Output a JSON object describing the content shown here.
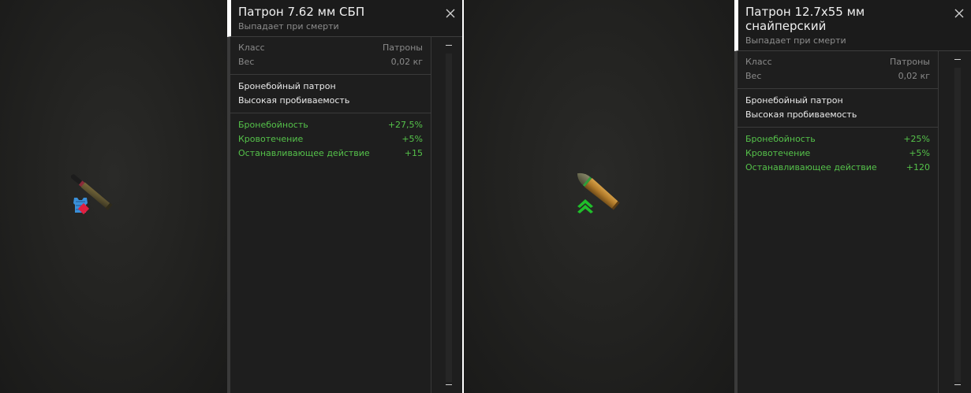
{
  "items": [
    {
      "title": "Патрон 7.62 мм СБП",
      "subtitle": "Выпадает при смерти",
      "class_label": "Класс",
      "class_value": "Патроны",
      "weight_label": "Вес",
      "weight_value": "0,02 кг",
      "desc_line1": "Бронебойный патрон",
      "desc_line2": "Высокая пробиваемость",
      "stats": [
        {
          "label": "Бронебойность",
          "value": "+27,5%"
        },
        {
          "label": "Кровотечение",
          "value": "+5%"
        },
        {
          "label": "Останавливающее действие",
          "value": "+15"
        }
      ]
    },
    {
      "title": "Патрон 12.7x55 мм снайперский",
      "subtitle": "Выпадает при смерти",
      "class_label": "Класс",
      "class_value": "Патроны",
      "weight_label": "Вес",
      "weight_value": "0,02 кг",
      "desc_line1": "Бронебойный патрон",
      "desc_line2": "Высокая пробиваемость",
      "stats": [
        {
          "label": "Бронебойность",
          "value": "+25%"
        },
        {
          "label": "Кровотечение",
          "value": "+5%"
        },
        {
          "label": "Останавливающее действие",
          "value": "+120"
        }
      ]
    }
  ],
  "icons": {
    "close": "close-icon",
    "armor_vest": "armor-vest-icon",
    "rank_up": "rank-up-chevron-icon"
  },
  "colors": {
    "stat_green": "#55c24a",
    "accent_white": "#ffffff"
  }
}
